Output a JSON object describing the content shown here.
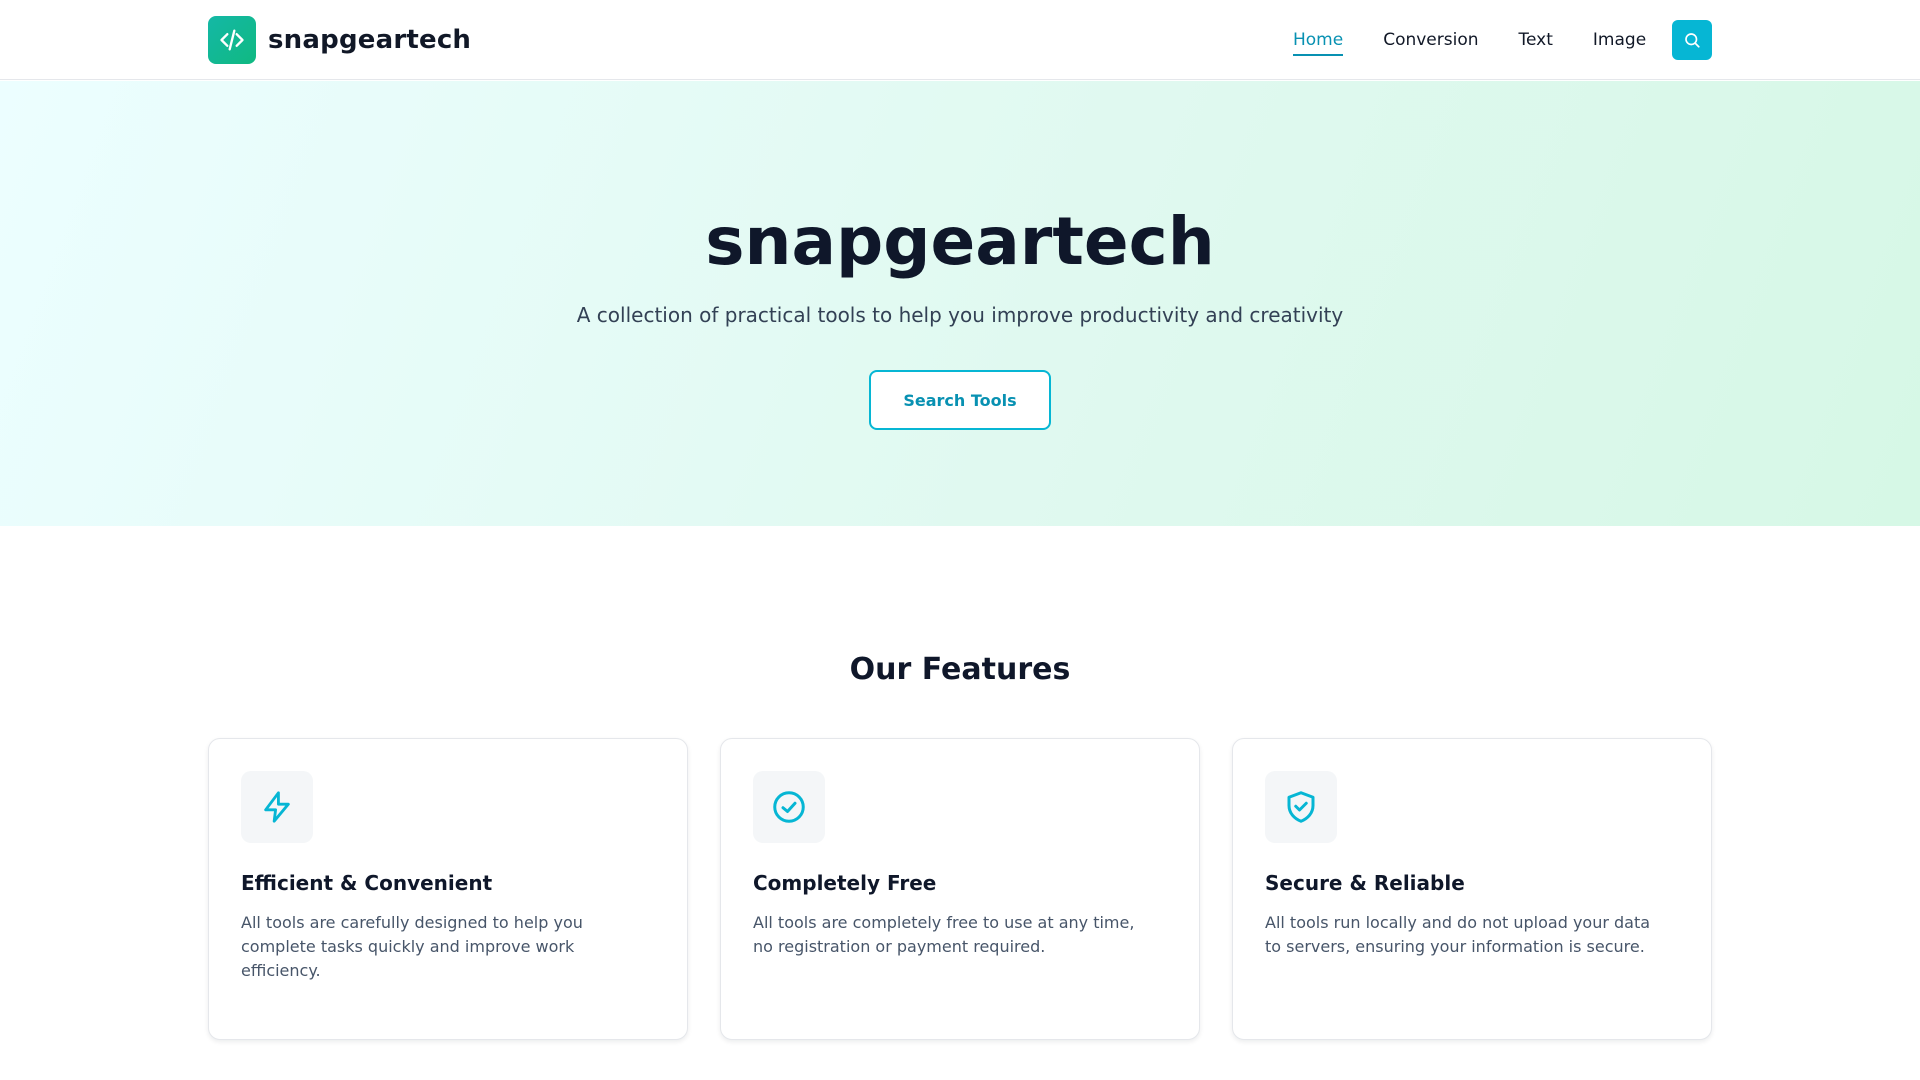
{
  "colors": {
    "accent": "#06b6d4",
    "accent_text": "#0891b2",
    "logo_gradient_start": "#14b8a6",
    "logo_gradient_end": "#10b981",
    "heading": "#0f172a",
    "body_text": "#475569"
  },
  "header": {
    "brand": "snapgeartech",
    "logo_icon": "code-icon",
    "nav": [
      {
        "label": "Home",
        "active": true
      },
      {
        "label": "Conversion",
        "active": false
      },
      {
        "label": "Text",
        "active": false
      },
      {
        "label": "Image",
        "active": false
      }
    ],
    "search_icon": "search-icon"
  },
  "hero": {
    "title": "snapgeartech",
    "subtitle": "A collection of practical tools to help you improve productivity and creativity",
    "cta_label": "Search Tools"
  },
  "features": {
    "heading": "Our Features",
    "items": [
      {
        "icon": "lightning-icon",
        "title": "Efficient & Convenient",
        "description": "All tools are carefully designed to help you complete tasks quickly and improve work efficiency."
      },
      {
        "icon": "check-circle-icon",
        "title": "Completely Free",
        "description": "All tools are completely free to use at any time, no registration or payment required."
      },
      {
        "icon": "shield-check-icon",
        "title": "Secure & Reliable",
        "description": "All tools run locally and do not upload your data to servers, ensuring your information is secure."
      }
    ]
  }
}
